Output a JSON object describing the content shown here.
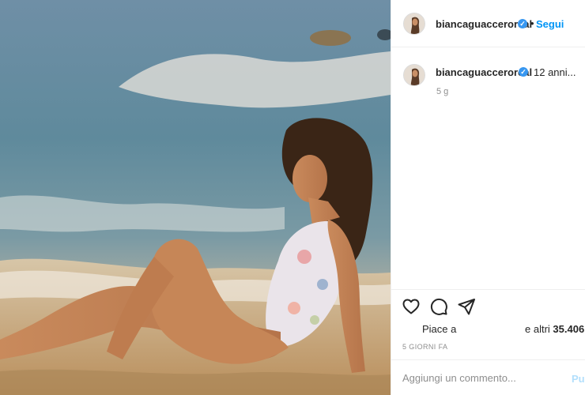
{
  "post": {
    "photo_alt": "foto",
    "author": {
      "username": "biancaguacceroreal",
      "verified_icon": "verified-check-icon"
    },
    "header": {
      "dot": "•",
      "follow_label": "Segui"
    },
    "caption": {
      "text": "12 anni...",
      "time": "5 g"
    },
    "actions": {
      "icons": [
        "heart-icon",
        "comment-icon",
        "share-icon"
      ]
    },
    "likes": {
      "prefix": "Piace a",
      "others_prefix": "e altri",
      "others_count": "35.406"
    },
    "posted_ago": "5 GIORNI FA",
    "comment_box": {
      "placeholder": "Aggiungi un commento...",
      "publish_label": "Pubblica"
    },
    "colors": {
      "accent": "#0095f6",
      "publish_disabled": "#b2dffc",
      "muted": "#8e8e8e",
      "verified": "#3897f0"
    }
  }
}
